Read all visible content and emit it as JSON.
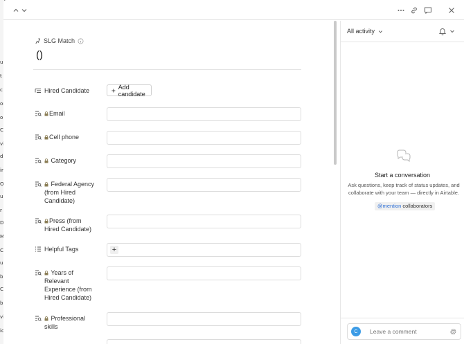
{
  "record": {
    "table_name": "SLG Match",
    "title": "()"
  },
  "fields": [
    {
      "label": "Hired Candidate",
      "type": "link",
      "button_label": "Add candidate"
    },
    {
      "label": "Email",
      "type": "lookup",
      "locked": true
    },
    {
      "label": "Cell phone",
      "type": "lookup",
      "locked": true
    },
    {
      "label": "Category",
      "type": "lookup",
      "locked": true
    },
    {
      "label": "Federal Agency (from Hired Candidate)",
      "type": "lookup",
      "locked": true
    },
    {
      "label": "Press (from Hired Candidate)",
      "type": "lookup",
      "locked": true
    },
    {
      "label": "Helpful Tags",
      "type": "multiselect"
    },
    {
      "label": "Years of Relevant Experience (from Hired Candidate)",
      "type": "lookup",
      "locked": true
    },
    {
      "label": "Professional skills",
      "type": "lookup",
      "locked": true
    }
  ],
  "sidebar": {
    "activity_filter": "All activity",
    "empty_title": "Start a conversation",
    "empty_desc": "Ask questions, keep track of status updates, and collaborate with your team — directly in Airtable.",
    "mention_at": "@mention",
    "mention_rest": " collaborators",
    "comment_placeholder": "Leave a comment",
    "avatar_initial": "C"
  },
  "background_letters": [
    "u",
    "t",
    "c",
    "or",
    "o",
    "C",
    "vi",
    "d",
    "ir",
    "O",
    "u",
    "r",
    "D",
    "M",
    "C",
    "u",
    "b",
    "C",
    "b",
    "vi",
    "ic"
  ],
  "colors": {
    "accent": "#2d6fd6",
    "avatar": "#3b9be6"
  }
}
